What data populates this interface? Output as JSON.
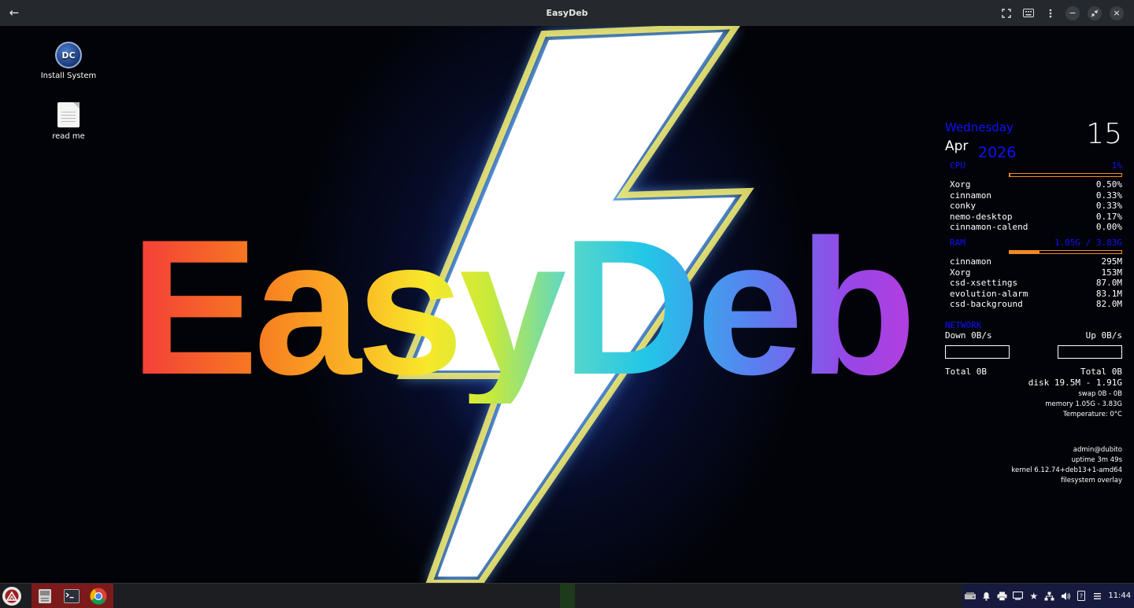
{
  "window": {
    "title": "EasyDeb"
  },
  "desktop": {
    "logo_text": "EasyDeb",
    "icons": [
      {
        "label": "Install System",
        "icon": "dc-installer-icon"
      },
      {
        "label": "read me",
        "icon": "document-icon"
      }
    ]
  },
  "conky": {
    "day": "Wednesday",
    "date": "15",
    "month": "Apr",
    "year": "2026",
    "cpu": {
      "label": "CPU",
      "value": "1%",
      "usage_fraction": 0.01
    },
    "cpu_processes": [
      {
        "name": "Xorg",
        "value": "0.50%"
      },
      {
        "name": "cinnamon",
        "value": "0.33%"
      },
      {
        "name": "conky",
        "value": "0.33%"
      },
      {
        "name": "nemo-desktop",
        "value": "0.17%"
      },
      {
        "name": "cinnamon-calend",
        "value": "0.00%"
      }
    ],
    "ram": {
      "label": "RAM",
      "value": "1.05G / 3.83G",
      "usage_fraction": 0.27
    },
    "ram_processes": [
      {
        "name": "cinnamon",
        "value": "295M"
      },
      {
        "name": "Xorg",
        "value": "153M"
      },
      {
        "name": "csd-xsettings",
        "value": "87.0M"
      },
      {
        "name": "evolution-alarm",
        "value": "83.1M"
      },
      {
        "name": "csd-background",
        "value": "82.0M"
      }
    ],
    "network": {
      "label": "NETWORK",
      "down": "Down 0B/s",
      "up": "Up 0B/s",
      "total_down": "Total 0B",
      "total_up": "Total 0B"
    },
    "disk": "disk 19.5M - 1.91G",
    "swap": "swap 0B - 0B",
    "memory": "memory 1.05G - 3.83G",
    "temperature": "Temperature: 0°C",
    "user": "admin@dubito",
    "uptime": "uptime 3m 49s",
    "kernel": "kernel 6.12.74+deb13+1-amd64",
    "filesystem": "filesystem overlay"
  },
  "taskbar": {
    "clock": "11:44"
  },
  "colors": {
    "accent_blue": "#1010ff",
    "bar_orange": "#f08a24",
    "launcher_bg": "#7a1a1a",
    "tray_bg": "#161a3e"
  }
}
